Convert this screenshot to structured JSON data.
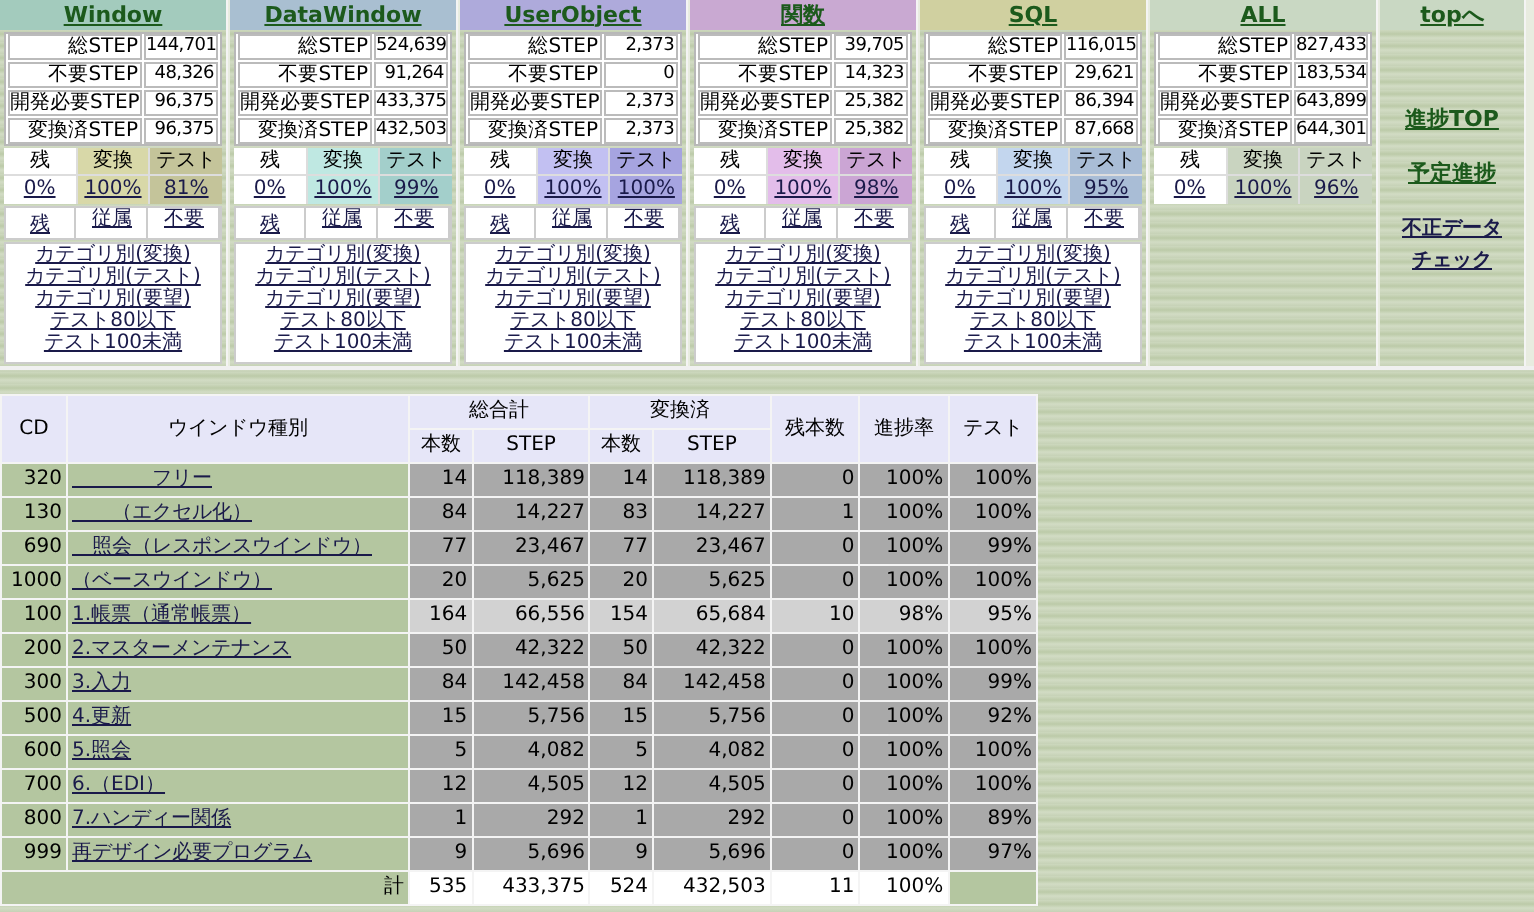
{
  "sections": [
    {
      "title": "Window",
      "color": "#a3cbbd",
      "stats": [
        {
          "label": "総STEP",
          "value": "144,701"
        },
        {
          "label": "不要STEP",
          "value": "48,326"
        },
        {
          "label": "開発必要STEP",
          "value": "96,375"
        },
        {
          "label": "変換済STEP",
          "value": "96,375"
        }
      ],
      "rate_headers": [
        "残",
        "変換",
        "テスト"
      ],
      "rates": [
        "0%",
        "100%",
        "81%"
      ],
      "filter_links": [
        "残",
        "従属",
        "不要"
      ],
      "category_links": [
        "カテゴリ別(変換)",
        "カテゴリ別(テスト)",
        "カテゴリ別(要望)",
        "テスト80以下",
        "テスト100未満"
      ]
    },
    {
      "title": "DataWindow",
      "color": "#a9bfd1",
      "stats": [
        {
          "label": "総STEP",
          "value": "524,639"
        },
        {
          "label": "不要STEP",
          "value": "91,264"
        },
        {
          "label": "開発必要STEP",
          "value": "433,375"
        },
        {
          "label": "変換済STEP",
          "value": "432,503"
        }
      ],
      "rate_headers": [
        "残",
        "変換",
        "テスト"
      ],
      "rates": [
        "0%",
        "100%",
        "99%"
      ],
      "filter_links": [
        "残",
        "従属",
        "不要"
      ],
      "category_links": [
        "カテゴリ別(変換)",
        "カテゴリ別(テスト)",
        "カテゴリ別(要望)",
        "テスト80以下",
        "テスト100未満"
      ]
    },
    {
      "title": "UserObject",
      "color": "#aeaadb",
      "stats": [
        {
          "label": "総STEP",
          "value": "2,373"
        },
        {
          "label": "不要STEP",
          "value": "0"
        },
        {
          "label": "開発必要STEP",
          "value": "2,373"
        },
        {
          "label": "変換済STEP",
          "value": "2,373"
        }
      ],
      "rate_headers": [
        "残",
        "変換",
        "テスト"
      ],
      "rates": [
        "0%",
        "100%",
        "100%"
      ],
      "filter_links": [
        "残",
        "従属",
        "不要"
      ],
      "category_links": [
        "カテゴリ別(変換)",
        "カテゴリ別(テスト)",
        "カテゴリ別(要望)",
        "テスト80以下",
        "テスト100未満"
      ]
    },
    {
      "title": "関数",
      "color": "#c9a9d2",
      "stats": [
        {
          "label": "総STEP",
          "value": "39,705"
        },
        {
          "label": "不要STEP",
          "value": "14,323"
        },
        {
          "label": "開発必要STEP",
          "value": "25,382"
        },
        {
          "label": "変換済STEP",
          "value": "25,382"
        }
      ],
      "rate_headers": [
        "残",
        "変換",
        "テスト"
      ],
      "rates": [
        "0%",
        "100%",
        "98%"
      ],
      "filter_links": [
        "残",
        "従属",
        "不要"
      ],
      "category_links": [
        "カテゴリ別(変換)",
        "カテゴリ別(テスト)",
        "カテゴリ別(要望)",
        "テスト80以下",
        "テスト100未満"
      ]
    },
    {
      "title": "SQL",
      "color": "#d0d0a0",
      "stats": [
        {
          "label": "総STEP",
          "value": "116,015"
        },
        {
          "label": "不要STEP",
          "value": "29,621"
        },
        {
          "label": "開発必要STEP",
          "value": "86,394"
        },
        {
          "label": "変換済STEP",
          "value": "87,668"
        }
      ],
      "rate_headers": [
        "残",
        "変換",
        "テスト"
      ],
      "rates": [
        "0%",
        "100%",
        "95%"
      ],
      "filter_links": [
        "残",
        "従属",
        "不要"
      ],
      "category_links": [
        "カテゴリ別(変換)",
        "カテゴリ別(テスト)",
        "カテゴリ別(要望)",
        "テスト80以下",
        "テスト100未満"
      ]
    },
    {
      "title": "ALL",
      "color": "#c9d8c3",
      "stats": [
        {
          "label": "総STEP",
          "value": "827,433"
        },
        {
          "label": "不要STEP",
          "value": "183,534"
        },
        {
          "label": "開発必要STEP",
          "value": "643,899"
        },
        {
          "label": "変換済STEP",
          "value": "644,301"
        }
      ],
      "rate_headers": [
        "残",
        "変換",
        "テスト"
      ],
      "rates": [
        "0%",
        "100%",
        "96%"
      ]
    }
  ],
  "nav": {
    "title": "topへ",
    "links": [
      "進捗TOP",
      "予定進捗",
      "不正データチェック"
    ]
  },
  "table": {
    "columns": [
      "CD",
      "ウインドウ種別",
      "総合計",
      "変換済",
      "残本数",
      "進捗率",
      "テスト"
    ],
    "subcolumns": [
      "本数",
      "STEP",
      "本数",
      "STEP"
    ],
    "rows": [
      {
        "cd": "320",
        "name": "　　　　フリー",
        "count_total": "14",
        "step_total": "118,389",
        "count_done": "14",
        "step_done": "118,389",
        "remaining": "0",
        "progress": "100%",
        "test": "100%",
        "highlighted": false
      },
      {
        "cd": "130",
        "name": "　　（エクセル化）",
        "count_total": "84",
        "step_total": "14,227",
        "count_done": "83",
        "step_done": "14,227",
        "remaining": "1",
        "progress": "100%",
        "test": "100%",
        "highlighted": false
      },
      {
        "cd": "690",
        "name": "　照会（レスポンスウインドウ）",
        "count_total": "77",
        "step_total": "23,467",
        "count_done": "77",
        "step_done": "23,467",
        "remaining": "0",
        "progress": "100%",
        "test": "99%",
        "highlighted": false
      },
      {
        "cd": "1000",
        "name": "（ベースウインドウ）",
        "count_total": "20",
        "step_total": "5,625",
        "count_done": "20",
        "step_done": "5,625",
        "remaining": "0",
        "progress": "100%",
        "test": "100%",
        "highlighted": false
      },
      {
        "cd": "100",
        "name": "1.帳票（通常帳票）",
        "count_total": "164",
        "step_total": "66,556",
        "count_done": "154",
        "step_done": "65,684",
        "remaining": "10",
        "progress": "98%",
        "test": "95%",
        "highlighted": true
      },
      {
        "cd": "200",
        "name": "2.マスターメンテナンス",
        "count_total": "50",
        "step_total": "42,322",
        "count_done": "50",
        "step_done": "42,322",
        "remaining": "0",
        "progress": "100%",
        "test": "100%",
        "highlighted": false
      },
      {
        "cd": "300",
        "name": "3.入力",
        "count_total": "84",
        "step_total": "142,458",
        "count_done": "84",
        "step_done": "142,458",
        "remaining": "0",
        "progress": "100%",
        "test": "99%",
        "highlighted": false
      },
      {
        "cd": "500",
        "name": "4.更新",
        "count_total": "15",
        "step_total": "5,756",
        "count_done": "15",
        "step_done": "5,756",
        "remaining": "0",
        "progress": "100%",
        "test": "92%",
        "highlighted": false
      },
      {
        "cd": "600",
        "name": "5.照会",
        "count_total": "5",
        "step_total": "4,082",
        "count_done": "5",
        "step_done": "4,082",
        "remaining": "0",
        "progress": "100%",
        "test": "100%",
        "highlighted": false
      },
      {
        "cd": "700",
        "name": "6.（EDI）",
        "count_total": "12",
        "step_total": "4,505",
        "count_done": "12",
        "step_done": "4,505",
        "remaining": "0",
        "progress": "100%",
        "test": "100%",
        "highlighted": false
      },
      {
        "cd": "800",
        "name": "7.ハンディー関係",
        "count_total": "1",
        "step_total": "292",
        "count_done": "1",
        "step_done": "292",
        "remaining": "0",
        "progress": "100%",
        "test": "89%",
        "highlighted": false
      },
      {
        "cd": "999",
        "name": "再デザイン必要プログラム",
        "count_total": "9",
        "step_total": "5,696",
        "count_done": "9",
        "step_done": "5,696",
        "remaining": "0",
        "progress": "100%",
        "test": "97%",
        "highlighted": false
      }
    ],
    "total": {
      "label": "計",
      "count_total": "535",
      "step_total": "433,375",
      "count_done": "524",
      "step_done": "432,503",
      "remaining": "11",
      "progress": "100%"
    }
  }
}
